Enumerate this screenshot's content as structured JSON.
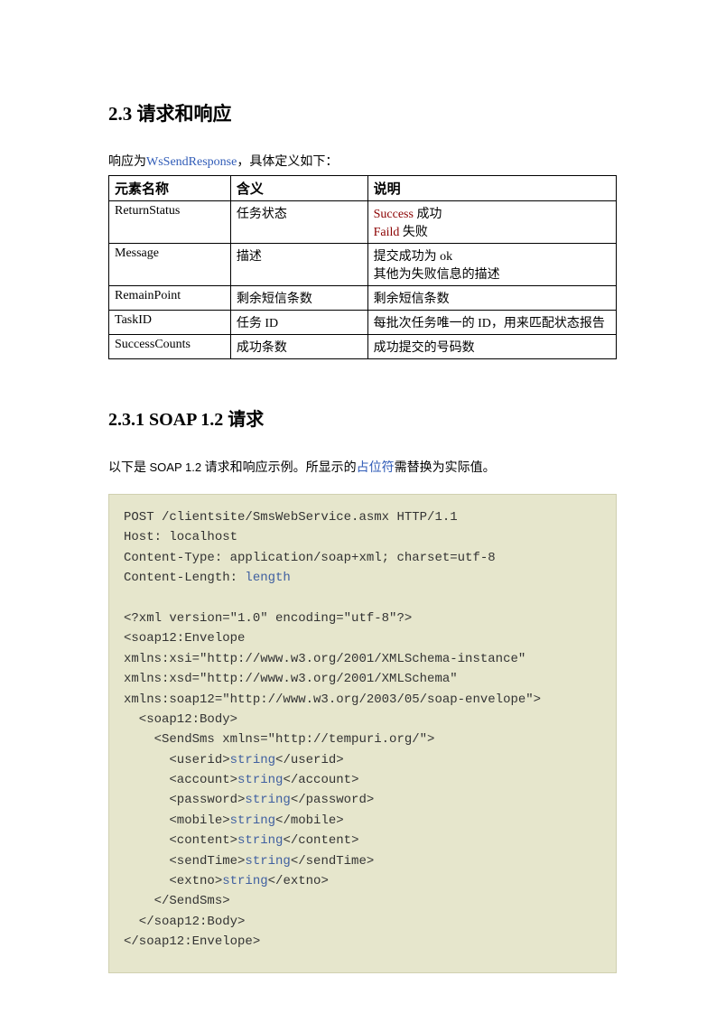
{
  "headings": {
    "h2_3": "2.3  请求和响应",
    "h2_3_1": "2.3.1  SOAP 1.2 请求"
  },
  "intro": {
    "prefix": "响应为",
    "link": "WsSendResponse",
    "suffix": "，具体定义如下："
  },
  "table": {
    "headers": [
      "元素名称",
      "含义",
      "说明"
    ],
    "rows": [
      {
        "c0": "ReturnStatus",
        "c1": "任务状态",
        "c2": {
          "line1_red": "Success",
          "line1_rest": "  成功",
          "line2_red": "Faild",
          "line2_rest": "  失败"
        }
      },
      {
        "c0": "Message",
        "c1": "描述",
        "c2": {
          "line1": "提交成功为  ok",
          "line2": "其他为失败信息的描述"
        }
      },
      {
        "c0": "RemainPoint",
        "c1": "剩余短信条数",
        "c2_plain": "剩余短信条数"
      },
      {
        "c0": "TaskID",
        "c1": "任务 ID",
        "c2_plain": "每批次任务唯一的 ID，用来匹配状态报告"
      },
      {
        "c0": "SuccessCounts",
        "c1": "成功条数",
        "c2_plain": "成功提交的号码数"
      }
    ]
  },
  "sub_intro": {
    "prefix": "以下是 ",
    "mono": "SOAP 1.2",
    "middle": "  请求和响应示例。所显示的",
    "link": "占位符",
    "suffix": "需替换为实际值。"
  },
  "code": {
    "l01": "POST /clientsite/SmsWebService.asmx HTTP/1.1",
    "l02": "Host: localhost",
    "l03": "Content-Type: application/soap+xml; charset=utf-8",
    "l04a": "Content-Length: ",
    "l04b": "length",
    "l06": "<?xml version=\"1.0\" encoding=\"utf-8\"?>",
    "l07": "<soap12:Envelope",
    "l08": "xmlns:xsi=\"http://www.w3.org/2001/XMLSchema-instance\"",
    "l09": "xmlns:xsd=\"http://www.w3.org/2001/XMLSchema\"",
    "l10": "xmlns:soap12=\"http://www.w3.org/2003/05/soap-envelope\">",
    "l11": "  <soap12:Body>",
    "l12": "    <SendSms xmlns=\"http://tempuri.org/\">",
    "l13a": "      <userid>",
    "l13b": "string",
    "l13c": "</userid>",
    "l14a": "      <account>",
    "l14b": "string",
    "l14c": "</account>",
    "l15a": "      <password>",
    "l15b": "string",
    "l15c": "</password>",
    "l16a": "      <mobile>",
    "l16b": "string",
    "l16c": "</mobile>",
    "l17a": "      <content>",
    "l17b": "string",
    "l17c": "</content>",
    "l18a": "      <sendTime>",
    "l18b": "string",
    "l18c": "</sendTime>",
    "l19a": "      <extno>",
    "l19b": "string",
    "l19c": "</extno>",
    "l20": "    </SendSms>",
    "l21": "  </soap12:Body>",
    "l22": "</soap12:Envelope>"
  }
}
